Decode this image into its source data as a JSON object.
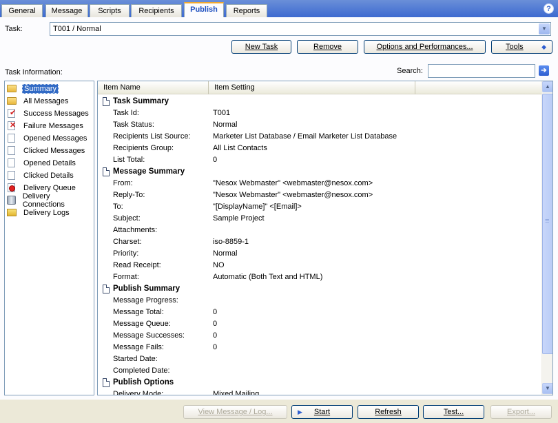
{
  "tabs": [
    {
      "label": "General",
      "active": false
    },
    {
      "label": "Message",
      "active": false
    },
    {
      "label": "Scripts",
      "active": false
    },
    {
      "label": "Recipients",
      "active": false
    },
    {
      "label": "Publish",
      "active": true
    },
    {
      "label": "Reports",
      "active": false
    }
  ],
  "help_symbol": "?",
  "task": {
    "label": "Task:",
    "value": "T001 / Normal"
  },
  "toolbar": {
    "new_task": "New Task",
    "remove": "Remove",
    "options": "Options and Performances...",
    "tools": "Tools"
  },
  "task_info_label": "Task Information:",
  "search": {
    "label": "Search:",
    "placeholder": ""
  },
  "nav": [
    {
      "label": "Summary",
      "icon": "folder-icon",
      "selected": true
    },
    {
      "label": "All Messages",
      "icon": "folder-icon",
      "selected": false
    },
    {
      "label": "Success Messages",
      "icon": "check-icon",
      "selected": false
    },
    {
      "label": "Failure Messages",
      "icon": "red-x-icon",
      "selected": false
    },
    {
      "label": "Opened Messages",
      "icon": "page-icon",
      "selected": false
    },
    {
      "label": "Clicked Messages",
      "icon": "page-icon",
      "selected": false
    },
    {
      "label": "Opened Details",
      "icon": "page-icon",
      "selected": false
    },
    {
      "label": "Clicked Details",
      "icon": "page-icon",
      "selected": false
    },
    {
      "label": "Delivery Queue",
      "icon": "stop-icon",
      "selected": false
    },
    {
      "label": "Delivery Connections",
      "icon": "database-icon",
      "selected": false
    },
    {
      "label": "Delivery Logs",
      "icon": "log-icon",
      "selected": false
    }
  ],
  "grid": {
    "col_name": "Item Name",
    "col_setting": "Item Setting",
    "rows": [
      {
        "type": "section",
        "name": "Task Summary",
        "value": ""
      },
      {
        "type": "item",
        "name": "Task Id:",
        "value": "T001"
      },
      {
        "type": "item",
        "name": "Task Status:",
        "value": "Normal"
      },
      {
        "type": "item",
        "name": "Recipients List Source:",
        "value": "Marketer List Database / Email Marketer List Database"
      },
      {
        "type": "item",
        "name": "Recipients Group:",
        "value": "All List Contacts"
      },
      {
        "type": "item",
        "name": "List Total:",
        "value": "0"
      },
      {
        "type": "section",
        "name": "Message Summary",
        "value": ""
      },
      {
        "type": "item",
        "name": "From:",
        "value": "\"Nesox Webmaster\" <webmaster@nesox.com>"
      },
      {
        "type": "item",
        "name": "Reply-To:",
        "value": "\"Nesox Webmaster\" <webmaster@nesox.com>"
      },
      {
        "type": "item",
        "name": "To:",
        "value": "\"[DisplayName]\" <[Email]>"
      },
      {
        "type": "item",
        "name": "Subject:",
        "value": "Sample Project"
      },
      {
        "type": "item",
        "name": "Attachments:",
        "value": ""
      },
      {
        "type": "item",
        "name": "Charset:",
        "value": "iso-8859-1"
      },
      {
        "type": "item",
        "name": "Priority:",
        "value": "Normal"
      },
      {
        "type": "item",
        "name": "Read Receipt:",
        "value": "NO"
      },
      {
        "type": "item",
        "name": "Format:",
        "value": "Automatic (Both Text and HTML)"
      },
      {
        "type": "section",
        "name": "Publish Summary",
        "value": ""
      },
      {
        "type": "item",
        "name": "Message Progress:",
        "value": ""
      },
      {
        "type": "item",
        "name": "Message Total:",
        "value": "0"
      },
      {
        "type": "item",
        "name": "Message Queue:",
        "value": "0"
      },
      {
        "type": "item",
        "name": "Message Successes:",
        "value": "0"
      },
      {
        "type": "item",
        "name": "Message Fails:",
        "value": "0"
      },
      {
        "type": "item",
        "name": "Started Date:",
        "value": ""
      },
      {
        "type": "item",
        "name": "Completed Date:",
        "value": ""
      },
      {
        "type": "section",
        "name": "Publish Options",
        "value": ""
      },
      {
        "type": "item",
        "name": "Delivery Mode:",
        "value": "Mixed Mailing"
      }
    ]
  },
  "bottom": {
    "view_log": "View Message / Log...",
    "start": "Start",
    "refresh": "Refresh",
    "test": "Test...",
    "export": "Export..."
  }
}
